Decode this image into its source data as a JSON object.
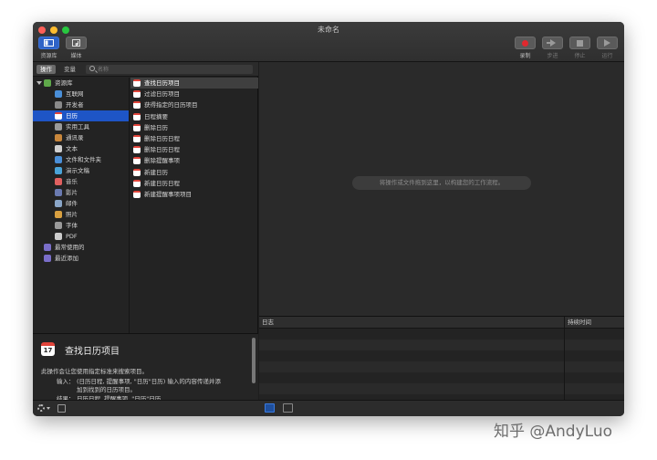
{
  "window": {
    "title": "未命名"
  },
  "toolbar": {
    "library_label": "资源库",
    "media_label": "媒体",
    "record_label": "录制",
    "step_label": "步进",
    "stop_label": "停止",
    "run_label": "运行"
  },
  "panel": {
    "tab_actions": "操作",
    "tab_variables": "变量",
    "search_placeholder": "名称"
  },
  "library": {
    "root": "资源库",
    "items": [
      "互联网",
      "开发者",
      "日历",
      "实用工具",
      "通讯录",
      "文本",
      "文件和文件夹",
      "演示文稿",
      "音乐",
      "影片",
      "邮件",
      "照片",
      "字体",
      "PDF"
    ],
    "selected_index": 2,
    "groups": [
      "最常使用的",
      "最近添加"
    ]
  },
  "actions": {
    "items": [
      "查找日历项目",
      "过滤日历项目",
      "获得指定的日历项目",
      "日程摘要",
      "删除日历",
      "删除日历日程",
      "删除日历日程",
      "删除提醒事项",
      "新建日历",
      "新建日历日程",
      "新建提醒事项项目"
    ],
    "selected_index": 0,
    "cal_glyph": "17"
  },
  "description": {
    "title": "查找日历项目",
    "text": "此操作会让您使用指定标准来搜索项目。",
    "input_label": "输入：",
    "input_line1": "(日历日程, 提醒事项, \"日历\"日历) 输入的内容传递并添",
    "input_line2": "加到找到的日历项目。",
    "result_label": "结果：",
    "result_value": "日历日程, 提醒事项, \"日历\"日历"
  },
  "workflow": {
    "placeholder": "将操作或文件拖到这里，以构建您的工作流程。"
  },
  "log": {
    "col_log": "日志",
    "col_duration": "持续时间"
  },
  "watermark": "知乎 @AndyLuo"
}
